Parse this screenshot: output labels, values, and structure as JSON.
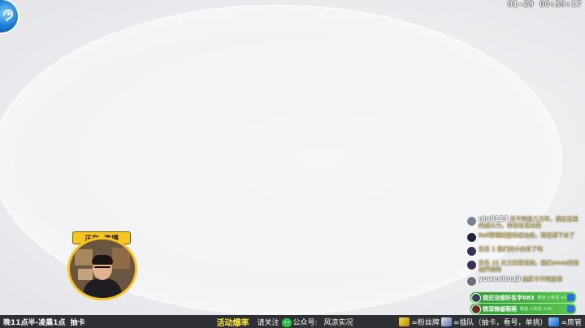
{
  "overlay": {
    "datetime": "01-29 00:39:17"
  },
  "camera": {
    "live_tag_left": "正在",
    "live_tag_right": "直播"
  },
  "chat": {
    "messages": [
      {
        "name": "nhdi123",
        "text": "还不同意几万年，我在这里的战斗力，你没有见过的"
      },
      {
        "name": "",
        "text": "Nell管理的整体运动会，现在都下去了"
      },
      {
        "name": "",
        "text": "乐乐 1 我们的小伙伴了吗"
      },
      {
        "name": "",
        "text": "乐乐 11 大力日常活动，我们emoz的活动开始啦"
      },
      {
        "name": "yuwenhuaji",
        "text": "抽奖卡不同意领"
      }
    ],
    "gifts": [
      {
        "name": "我还没想好名字883",
        "sub": "赠送 小花花 ×1"
      },
      {
        "name": "情深辣椒萌萌",
        "sub": "赠送 小花花 ×10"
      }
    ]
  },
  "bottom_bar": {
    "schedule": "晚11点半-凌晨1点",
    "schedule_item": "抽卡",
    "hot_label": "活动爆率",
    "follow_prefix": "请关注",
    "account_label": "公众号:",
    "account_name": "风凉实况",
    "legend_fan": "=粉丝牌",
    "legend_queue": "=插队（抽卡，看号，单挑）",
    "legend_room": "=房管"
  }
}
